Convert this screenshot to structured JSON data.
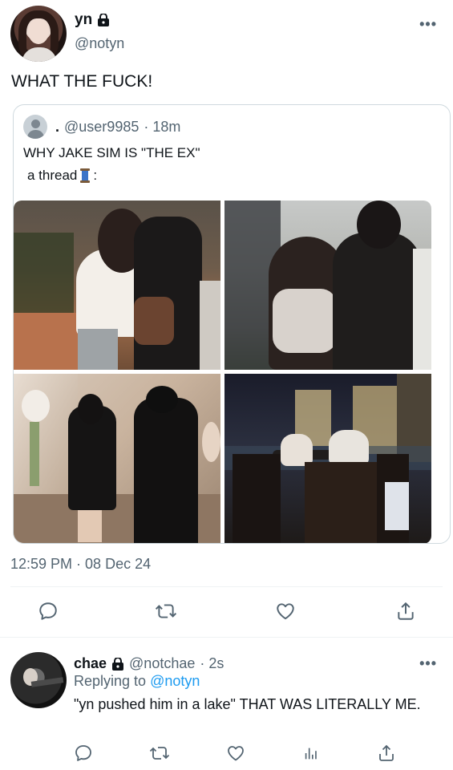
{
  "tweet": {
    "display_name": "yn",
    "handle": "@notyn",
    "text": "WHAT THE FUCK!",
    "timestamp": "12:59 PM · 08 Dec 24",
    "more_icon": "more-horizontal-icon"
  },
  "quote": {
    "name": ".",
    "handle": "@user9985",
    "time": "· 18m",
    "line1": "WHY JAKE SIM IS \"THE EX\"",
    "line2": "a thread",
    "line2_suffix": ":",
    "photos": [
      "photo-1",
      "photo-2",
      "photo-3",
      "photo-4"
    ]
  },
  "actions": {
    "icons": [
      "reply-icon",
      "retweet-icon",
      "like-icon",
      "share-icon"
    ]
  },
  "reply": {
    "display_name": "chae",
    "handle": "@notchae",
    "time": "· 2s",
    "replying_label": "Replying to",
    "replying_to": "@notyn",
    "text": "\"yn pushed him in a lake\" THAT WAS LITERALLY ME.",
    "action_icons": [
      "reply-icon",
      "retweet-icon",
      "like-icon",
      "analytics-icon",
      "share-icon"
    ]
  },
  "colors": {
    "text": "#0f1419",
    "secondary": "#536471",
    "link": "#1d9bf0",
    "border": "#cfd9de"
  }
}
